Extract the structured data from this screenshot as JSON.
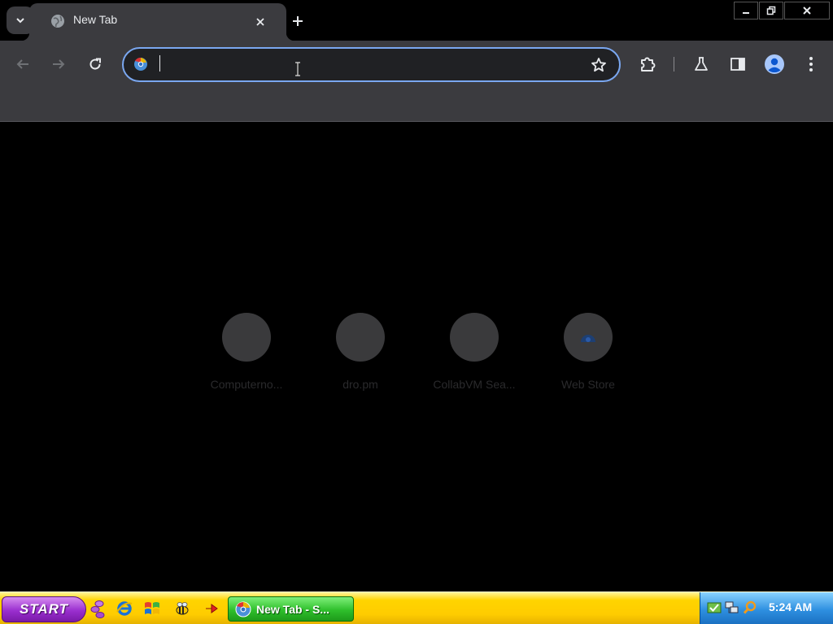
{
  "browser": {
    "tabs": [
      {
        "title": "New Tab",
        "favicon": "globe-icon",
        "active": true
      }
    ],
    "new_tab_icon": "plus-icon",
    "window_controls": [
      "minimize-icon",
      "restore-icon",
      "close-icon"
    ]
  },
  "toolbar": {
    "back_icon": "arrow-left-icon",
    "forward_icon": "arrow-right-icon",
    "reload_icon": "reload-icon",
    "omnibox": {
      "value": "",
      "placeholder": "",
      "bookmark_icon": "star-icon"
    },
    "actions": [
      "puzzle-icon",
      "flask-icon",
      "side-panel-icon",
      "profile-icon",
      "kebab-menu-icon"
    ]
  },
  "new_tab_page": {
    "shortcuts": [
      {
        "label": "Computerno...",
        "icon": ""
      },
      {
        "label": "dro.pm",
        "icon": ""
      },
      {
        "label": "CollabVM Sea...",
        "icon": ""
      },
      {
        "label": "Web Store",
        "icon": "web-store-icon"
      }
    ]
  },
  "taskbar": {
    "start_label": "START",
    "quick_launch": [
      "purple-people-icon",
      "internet-explorer-icon",
      "windows-flag-icon",
      "bee-icon",
      "red-arrow-icon"
    ],
    "tasks": [
      {
        "label": "New Tab - S...",
        "icon": "chrome-icon",
        "active": true
      }
    ],
    "tray_icons": [
      "security-icon",
      "network-icon",
      "search-icon"
    ],
    "clock": "5:24 AM"
  },
  "colors": {
    "accent": "#7aa7f0",
    "tab_bg": "#3b3b3f",
    "taskbar_yellow": "#ffcc00",
    "start_purple": "#9a2fcf",
    "task_green": "#2fbf2c",
    "tray_blue": "#2e8fe0"
  }
}
